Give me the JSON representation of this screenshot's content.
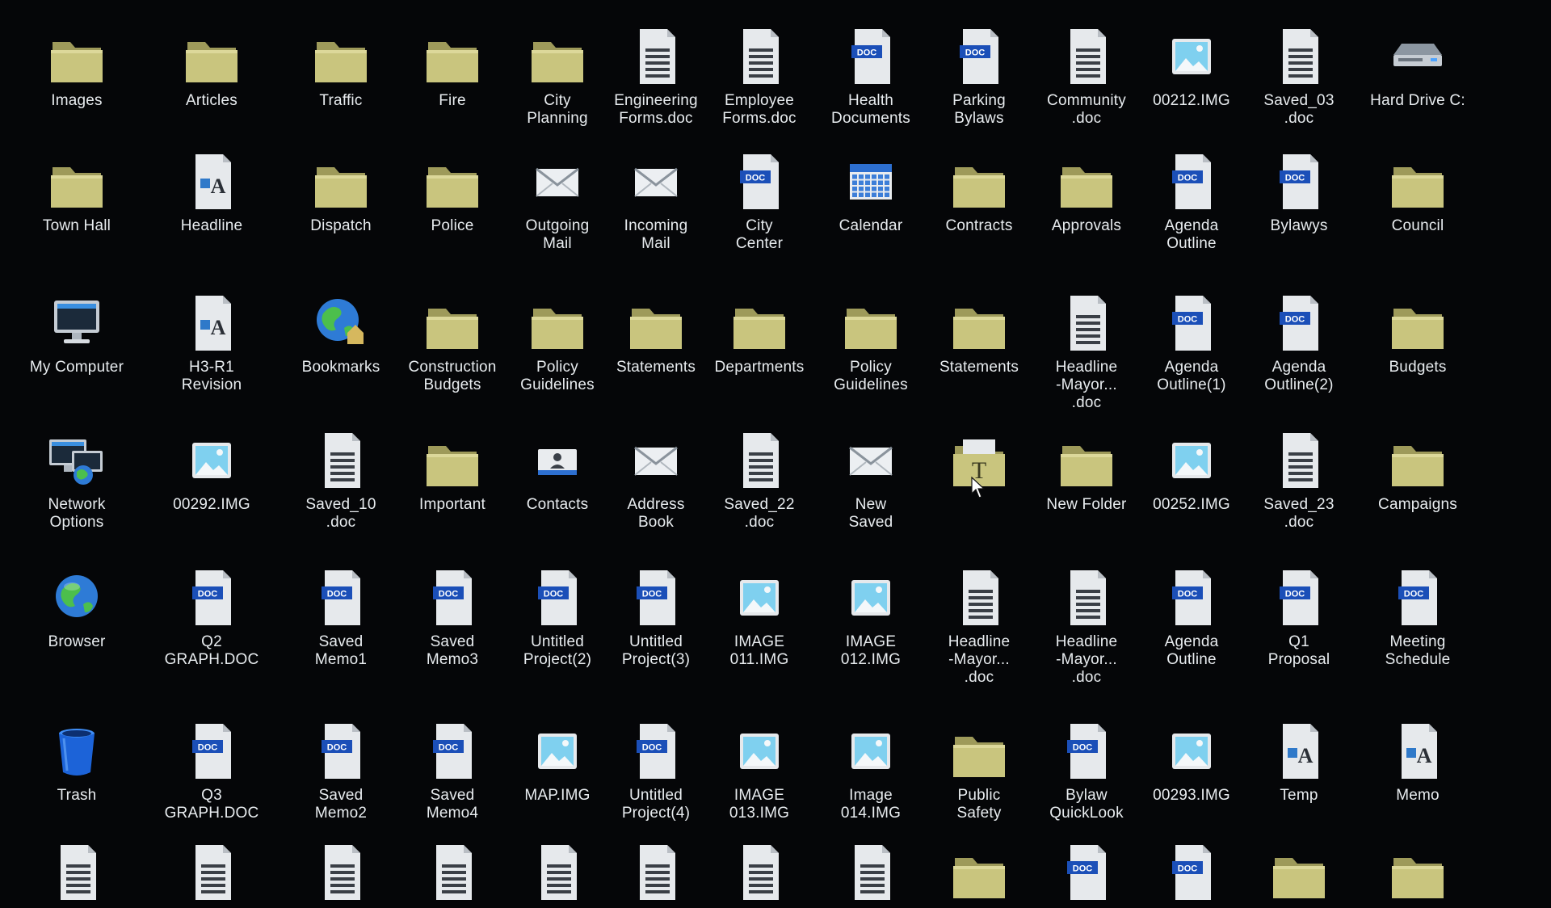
{
  "desktop": {
    "background": "#050608",
    "rows": [
      [
        {
          "icon": "folder-icon",
          "label": "Images"
        },
        {
          "icon": "folder-icon",
          "label": "Articles"
        },
        {
          "icon": "folder-icon",
          "label": "Traffic"
        },
        {
          "icon": "folder-icon",
          "label": "Fire"
        },
        {
          "icon": "folder-icon",
          "label": "City\nPlanning"
        },
        {
          "icon": "text-document-icon",
          "label": "Engineering\nForms.doc"
        },
        {
          "icon": "text-document-icon",
          "label": "Employee\nForms.doc"
        },
        {
          "icon": "doc-file-icon",
          "label": "Health\nDocuments"
        },
        {
          "icon": "doc-file-icon",
          "label": "Parking\nBylaws"
        },
        {
          "icon": "text-document-icon",
          "label": "Community\n.doc"
        },
        {
          "icon": "image-file-icon",
          "label": "00212.IMG"
        },
        {
          "icon": "text-document-icon",
          "label": "Saved_03\n.doc"
        },
        {
          "icon": "hard-drive-icon",
          "label": "Hard Drive C:"
        }
      ],
      [
        {
          "icon": "folder-icon",
          "label": "Town Hall"
        },
        {
          "icon": "rich-text-file-icon",
          "label": "Headline"
        },
        {
          "icon": "folder-icon",
          "label": "Dispatch"
        },
        {
          "icon": "folder-icon",
          "label": "Police"
        },
        {
          "icon": "mail-icon",
          "label": "Outgoing\nMail"
        },
        {
          "icon": "mail-icon",
          "label": "Incoming\nMail"
        },
        {
          "icon": "doc-file-icon",
          "label": "City\nCenter"
        },
        {
          "icon": "calendar-icon",
          "label": "Calendar"
        },
        {
          "icon": "folder-icon",
          "label": "Contracts"
        },
        {
          "icon": "folder-icon",
          "label": "Approvals"
        },
        {
          "icon": "doc-file-icon",
          "label": "Agenda\nOutline"
        },
        {
          "icon": "doc-file-icon",
          "label": "Bylawys"
        },
        {
          "icon": "folder-icon",
          "label": "Council"
        }
      ],
      [
        {
          "icon": "computer-icon",
          "label": "My Computer"
        },
        {
          "icon": "rich-text-file-icon",
          "label": "H3-R1\nRevision"
        },
        {
          "icon": "bookmarks-globe-icon",
          "label": "Bookmarks"
        },
        {
          "icon": "folder-icon",
          "label": "Construction\nBudgets"
        },
        {
          "icon": "folder-icon",
          "label": "Policy\nGuidelines"
        },
        {
          "icon": "folder-icon",
          "label": "Statements"
        },
        {
          "icon": "folder-icon",
          "label": "Departments"
        },
        {
          "icon": "folder-icon",
          "label": "Policy\nGuidelines"
        },
        {
          "icon": "folder-icon",
          "label": "Statements"
        },
        {
          "icon": "text-document-icon",
          "label": "Headline\n-Mayor...\n.doc"
        },
        {
          "icon": "doc-file-icon",
          "label": "Agenda\nOutline(1)"
        },
        {
          "icon": "doc-file-icon",
          "label": "Agenda\nOutline(2)"
        },
        {
          "icon": "folder-icon",
          "label": "Budgets"
        }
      ],
      [
        {
          "icon": "network-icon",
          "label": "Network\nOptions"
        },
        {
          "icon": "image-file-icon",
          "label": "00292.IMG"
        },
        {
          "icon": "text-document-icon",
          "label": "Saved_10\n.doc"
        },
        {
          "icon": "folder-icon",
          "label": "Important"
        },
        {
          "icon": "contacts-icon",
          "label": "Contacts"
        },
        {
          "icon": "mail-icon",
          "label": "Address\nBook"
        },
        {
          "icon": "text-document-icon",
          "label": "Saved_22\n.doc"
        },
        {
          "icon": "mail-icon",
          "label": "New\nSaved"
        },
        {
          "icon": "font-folder-icon",
          "label": ""
        },
        {
          "icon": "folder-icon",
          "label": "New Folder"
        },
        {
          "icon": "image-file-icon",
          "label": "00252.IMG"
        },
        {
          "icon": "text-document-icon",
          "label": "Saved_23\n.doc"
        },
        {
          "icon": "folder-icon",
          "label": "Campaigns"
        }
      ],
      [
        {
          "icon": "globe-icon",
          "label": "Browser"
        },
        {
          "icon": "doc-file-icon",
          "label": "Q2\nGRAPH.DOC"
        },
        {
          "icon": "doc-file-icon",
          "label": "Saved\nMemo1"
        },
        {
          "icon": "doc-file-icon",
          "label": "Saved\nMemo3"
        },
        {
          "icon": "doc-file-icon",
          "label": "Untitled\nProject(2)"
        },
        {
          "icon": "doc-file-icon",
          "label": "Untitled\nProject(3)"
        },
        {
          "icon": "image-file-icon",
          "label": "IMAGE\n011.IMG"
        },
        {
          "icon": "image-file-icon",
          "label": "IMAGE\n012.IMG"
        },
        {
          "icon": "text-document-icon",
          "label": "Headline\n-Mayor...\n.doc"
        },
        {
          "icon": "text-document-icon",
          "label": "Headline\n-Mayor...\n.doc"
        },
        {
          "icon": "doc-file-icon",
          "label": "Agenda\nOutline"
        },
        {
          "icon": "doc-file-icon",
          "label": "Q1\nProposal"
        },
        {
          "icon": "doc-file-icon",
          "label": "Meeting\nSchedule"
        }
      ],
      [
        {
          "icon": "trash-icon",
          "label": "Trash"
        },
        {
          "icon": "doc-file-icon",
          "label": "Q3\nGRAPH.DOC"
        },
        {
          "icon": "doc-file-icon",
          "label": "Saved\nMemo2"
        },
        {
          "icon": "doc-file-icon",
          "label": "Saved\nMemo4"
        },
        {
          "icon": "image-file-icon",
          "label": "MAP.IMG"
        },
        {
          "icon": "doc-file-icon",
          "label": "Untitled\nProject(4)"
        },
        {
          "icon": "image-file-icon",
          "label": "IMAGE\n013.IMG"
        },
        {
          "icon": "image-file-icon",
          "label": "Image\n014.IMG"
        },
        {
          "icon": "folder-icon",
          "label": "Public\nSafety"
        },
        {
          "icon": "doc-file-icon",
          "label": "Bylaw\nQuickLook"
        },
        {
          "icon": "image-file-icon",
          "label": "00293.IMG"
        },
        {
          "icon": "rich-text-file-icon",
          "label": "Temp"
        },
        {
          "icon": "rich-text-file-icon",
          "label": "Memo"
        }
      ],
      [
        {
          "icon": "text-document-icon",
          "label": ""
        },
        {
          "icon": "text-document-icon",
          "label": ""
        },
        {
          "icon": "text-document-icon",
          "label": ""
        },
        {
          "icon": "text-document-icon",
          "label": ""
        },
        {
          "icon": "text-document-icon",
          "label": ""
        },
        {
          "icon": "text-document-icon",
          "label": ""
        },
        {
          "icon": "text-document-icon",
          "label": ""
        },
        {
          "icon": "text-document-icon",
          "label": ""
        },
        {
          "icon": "folder-icon",
          "label": ""
        },
        {
          "icon": "doc-file-icon",
          "label": ""
        },
        {
          "icon": "doc-file-icon",
          "label": ""
        },
        {
          "icon": "folder-icon",
          "label": ""
        },
        {
          "icon": "folder-icon",
          "label": ""
        }
      ]
    ]
  },
  "colors": {
    "folder": "#c9c57e",
    "document": "#e6e9ec",
    "doc_badge": "#1b4fb8",
    "label": "#e8ecef"
  }
}
